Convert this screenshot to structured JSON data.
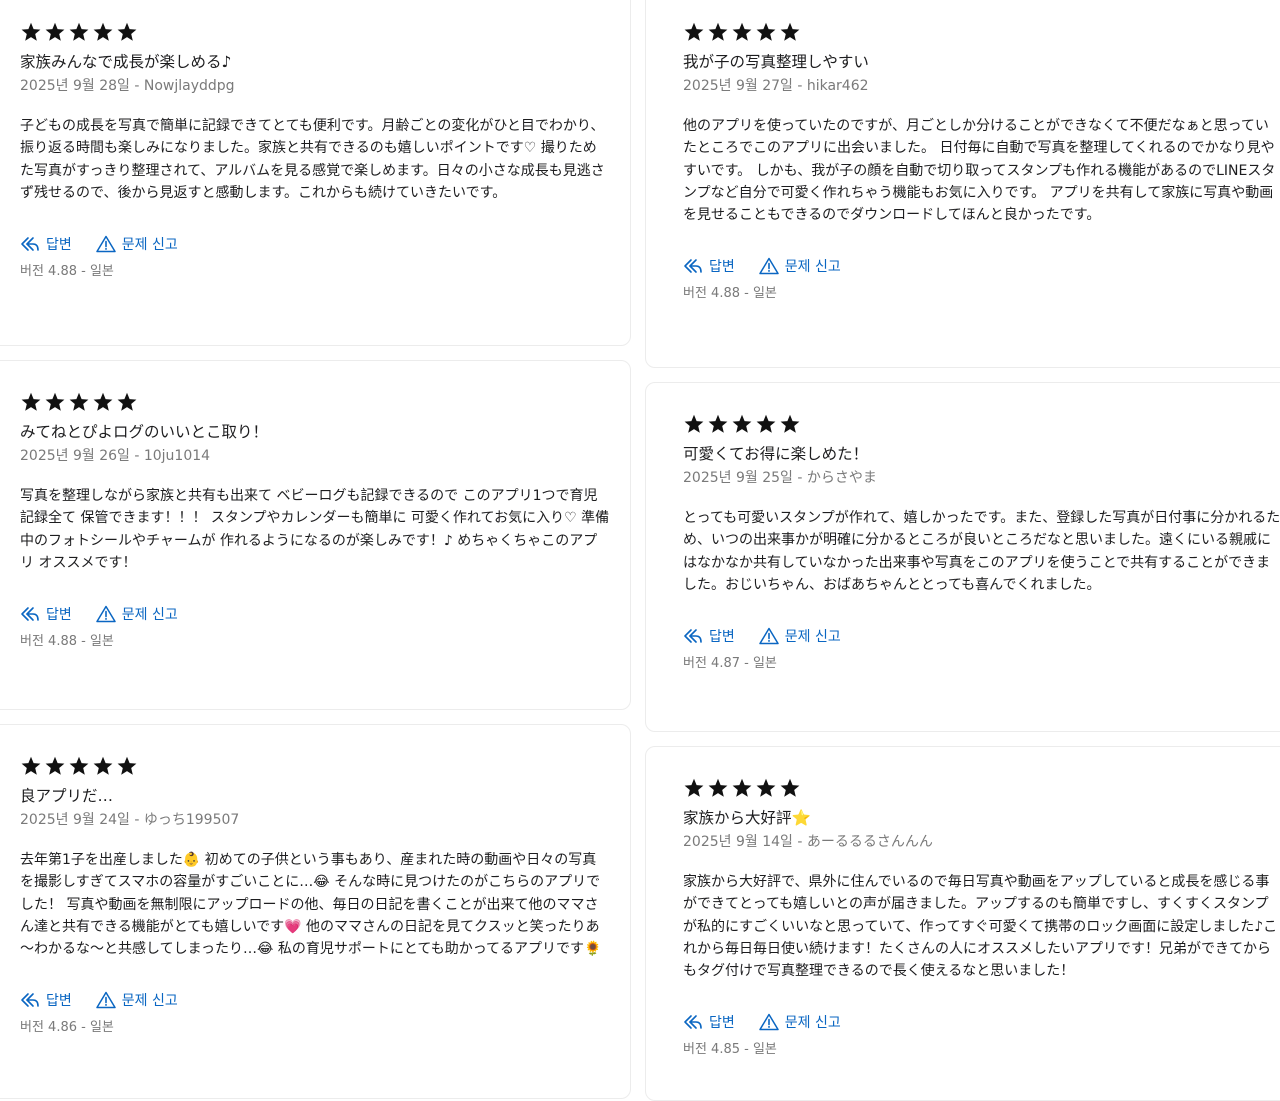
{
  "colors": {
    "link": "#0a66c2",
    "star": "#111111",
    "meta": "#7a7a7a"
  },
  "icons": {
    "star": "star-icon",
    "reply": "reply-icon",
    "report": "warning-icon"
  },
  "reviews": [
    {
      "rating": 5,
      "title": "家族みんなで成長が楽しめる♪",
      "meta": "2025년 9월 28일 - Nowjlayddpg",
      "body": "子どもの成長を写真で簡単に記録できてとても便利です。月齢ごとの変化がひと目でわかり、振り返る時間も楽しみになりました。家族と共有できるのも嬉しいポイントです♡ 撮りためた写真がすっきり整理されて、アルバムを見る感覚で楽しめます。日々の小さな成長も見逃さず残せるので、後から見返すと感動します。これからも続けていきたいです。",
      "reply_label": "답변",
      "report_label": "문제 신고",
      "version": "버전 4.88 - 일본"
    },
    {
      "rating": 5,
      "title": "我が子の写真整理しやすい",
      "meta": "2025년 9월 27일 - hikar462",
      "body": "他のアプリを使っていたのですが、月ごとしか分けることができなくて不便だなぁと思っていたところでこのアプリに出会いました。 日付毎に自動で写真を整理してくれるのでかなり見やすいです。 しかも、我が子の顔を自動で切り取ってスタンプも作れる機能があるのでLINEスタンプなど自分で可愛く作れちゃう機能もお気に入りです。 アプリを共有して家族に写真や動画を見せることもできるのでダウンロードしてほんと良かったです。",
      "reply_label": "답변",
      "report_label": "문제 신고",
      "version": "버전 4.88 - 일본"
    },
    {
      "rating": 5,
      "title": "みてねとぴよログのいいとこ取り！",
      "meta": "2025년 9월 26일 - 10ju1014",
      "body": "写真を整理しながら家族と共有も出来て ベビーログも記録できるので このアプリ1つで育児記録全て 保管できます！！！ スタンプやカレンダーも簡単に 可愛く作れてお気に入り♡ 準備中のフォトシールやチャームが 作れるようになるのが楽しみです！♪ めちゃくちゃこのアプリ オススメです！",
      "reply_label": "답변",
      "report_label": "문제 신고",
      "version": "버전 4.88 - 일본"
    },
    {
      "rating": 5,
      "title": "可愛くてお得に楽しめた！",
      "meta": "2025년 9월 25일 - からさやま",
      "body": "とっても可愛いスタンプが作れて、嬉しかったです。また、登録した写真が日付事に分かれるため、いつの出来事かが明確に分かるところが良いところだなと思いました。遠くにいる親戚にはなかなか共有していなかった出来事や写真をこのアプリを使うことで共有することができました。おじいちゃん、おばあちゃんととっても喜んでくれました。",
      "reply_label": "답변",
      "report_label": "문제 신고",
      "version": "버전 4.87 - 일본"
    },
    {
      "rating": 5,
      "title": "良アプリだ…",
      "meta": "2025년 9월 24일 - ゆっち199507",
      "body": "去年第1子を出産しました👶 初めての子供という事もあり、産まれた時の動画や日々の写真を撮影しすぎてスマホの容量がすごいことに…😂 そんな時に見つけたのがこちらのアプリでした！ 写真や動画を無制限にアップロードの他、毎日の日記を書くことが出来て他のママさん達と共有できる機能がとても嬉しいです💗 他のママさんの日記を見てクスッと笑ったりあ～わかるな～と共感してしまったり…😂 私の育児サポートにとても助かってるアプリです🌻",
      "reply_label": "답변",
      "report_label": "문제 신고",
      "version": "버전 4.86 - 일본"
    },
    {
      "rating": 5,
      "title": "家族から大好評⭐️",
      "meta": "2025년 9월 14일 - あーるるるさんんん",
      "body": "家族から大好評で、県外に住んでいるので毎日写真や動画をアップしていると成長を感じる事ができてとっても嬉しいとの声が届きました。アップするのも簡単ですし、すくすくスタンプが私的にすごくいいなと思っていて、作ってすぐ可愛くて携帯のロック画面に設定しました♪これから毎日毎日使い続けます！たくさんの人にオススメしたいアプリです！兄弟ができてからもタグ付けで写真整理できるので長く使えるなと思いました！",
      "reply_label": "답변",
      "report_label": "문제 신고",
      "version": "버전 4.85 - 일본"
    }
  ]
}
